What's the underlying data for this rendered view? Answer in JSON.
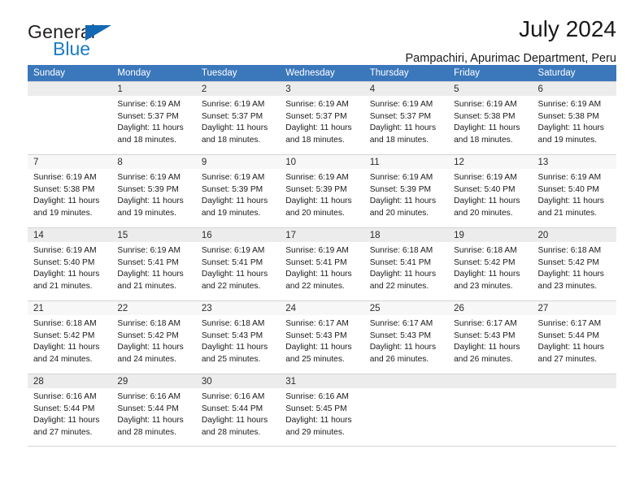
{
  "brand": {
    "name_part1": "General",
    "name_part2": "Blue",
    "triangle_color": "#1268b3",
    "blue_color": "#1b7bc4"
  },
  "header": {
    "title": "July 2024",
    "subtitle": "Pampachiri, Apurimac Department, Peru"
  },
  "colors": {
    "header_row_bg": "#3b77bb",
    "header_row_text": "#ffffff",
    "daynum_shaded": "#ececec",
    "daynum_plain": "#f7f7f7",
    "grid_line": "#d4d4d4"
  },
  "calendar": {
    "weekday_headers": [
      "Sunday",
      "Monday",
      "Tuesday",
      "Wednesday",
      "Thursday",
      "Friday",
      "Saturday"
    ],
    "weeks": [
      [
        {
          "day": "",
          "sunrise": "",
          "sunset": "",
          "daylight_line1": "",
          "daylight_line2": ""
        },
        {
          "day": "1",
          "sunrise": "Sunrise: 6:19 AM",
          "sunset": "Sunset: 5:37 PM",
          "daylight_line1": "Daylight: 11 hours",
          "daylight_line2": "and 18 minutes."
        },
        {
          "day": "2",
          "sunrise": "Sunrise: 6:19 AM",
          "sunset": "Sunset: 5:37 PM",
          "daylight_line1": "Daylight: 11 hours",
          "daylight_line2": "and 18 minutes."
        },
        {
          "day": "3",
          "sunrise": "Sunrise: 6:19 AM",
          "sunset": "Sunset: 5:37 PM",
          "daylight_line1": "Daylight: 11 hours",
          "daylight_line2": "and 18 minutes."
        },
        {
          "day": "4",
          "sunrise": "Sunrise: 6:19 AM",
          "sunset": "Sunset: 5:37 PM",
          "daylight_line1": "Daylight: 11 hours",
          "daylight_line2": "and 18 minutes."
        },
        {
          "day": "5",
          "sunrise": "Sunrise: 6:19 AM",
          "sunset": "Sunset: 5:38 PM",
          "daylight_line1": "Daylight: 11 hours",
          "daylight_line2": "and 18 minutes."
        },
        {
          "day": "6",
          "sunrise": "Sunrise: 6:19 AM",
          "sunset": "Sunset: 5:38 PM",
          "daylight_line1": "Daylight: 11 hours",
          "daylight_line2": "and 19 minutes."
        }
      ],
      [
        {
          "day": "7",
          "sunrise": "Sunrise: 6:19 AM",
          "sunset": "Sunset: 5:38 PM",
          "daylight_line1": "Daylight: 11 hours",
          "daylight_line2": "and 19 minutes."
        },
        {
          "day": "8",
          "sunrise": "Sunrise: 6:19 AM",
          "sunset": "Sunset: 5:39 PM",
          "daylight_line1": "Daylight: 11 hours",
          "daylight_line2": "and 19 minutes."
        },
        {
          "day": "9",
          "sunrise": "Sunrise: 6:19 AM",
          "sunset": "Sunset: 5:39 PM",
          "daylight_line1": "Daylight: 11 hours",
          "daylight_line2": "and 19 minutes."
        },
        {
          "day": "10",
          "sunrise": "Sunrise: 6:19 AM",
          "sunset": "Sunset: 5:39 PM",
          "daylight_line1": "Daylight: 11 hours",
          "daylight_line2": "and 20 minutes."
        },
        {
          "day": "11",
          "sunrise": "Sunrise: 6:19 AM",
          "sunset": "Sunset: 5:39 PM",
          "daylight_line1": "Daylight: 11 hours",
          "daylight_line2": "and 20 minutes."
        },
        {
          "day": "12",
          "sunrise": "Sunrise: 6:19 AM",
          "sunset": "Sunset: 5:40 PM",
          "daylight_line1": "Daylight: 11 hours",
          "daylight_line2": "and 20 minutes."
        },
        {
          "day": "13",
          "sunrise": "Sunrise: 6:19 AM",
          "sunset": "Sunset: 5:40 PM",
          "daylight_line1": "Daylight: 11 hours",
          "daylight_line2": "and 21 minutes."
        }
      ],
      [
        {
          "day": "14",
          "sunrise": "Sunrise: 6:19 AM",
          "sunset": "Sunset: 5:40 PM",
          "daylight_line1": "Daylight: 11 hours",
          "daylight_line2": "and 21 minutes."
        },
        {
          "day": "15",
          "sunrise": "Sunrise: 6:19 AM",
          "sunset": "Sunset: 5:41 PM",
          "daylight_line1": "Daylight: 11 hours",
          "daylight_line2": "and 21 minutes."
        },
        {
          "day": "16",
          "sunrise": "Sunrise: 6:19 AM",
          "sunset": "Sunset: 5:41 PM",
          "daylight_line1": "Daylight: 11 hours",
          "daylight_line2": "and 22 minutes."
        },
        {
          "day": "17",
          "sunrise": "Sunrise: 6:19 AM",
          "sunset": "Sunset: 5:41 PM",
          "daylight_line1": "Daylight: 11 hours",
          "daylight_line2": "and 22 minutes."
        },
        {
          "day": "18",
          "sunrise": "Sunrise: 6:18 AM",
          "sunset": "Sunset: 5:41 PM",
          "daylight_line1": "Daylight: 11 hours",
          "daylight_line2": "and 22 minutes."
        },
        {
          "day": "19",
          "sunrise": "Sunrise: 6:18 AM",
          "sunset": "Sunset: 5:42 PM",
          "daylight_line1": "Daylight: 11 hours",
          "daylight_line2": "and 23 minutes."
        },
        {
          "day": "20",
          "sunrise": "Sunrise: 6:18 AM",
          "sunset": "Sunset: 5:42 PM",
          "daylight_line1": "Daylight: 11 hours",
          "daylight_line2": "and 23 minutes."
        }
      ],
      [
        {
          "day": "21",
          "sunrise": "Sunrise: 6:18 AM",
          "sunset": "Sunset: 5:42 PM",
          "daylight_line1": "Daylight: 11 hours",
          "daylight_line2": "and 24 minutes."
        },
        {
          "day": "22",
          "sunrise": "Sunrise: 6:18 AM",
          "sunset": "Sunset: 5:42 PM",
          "daylight_line1": "Daylight: 11 hours",
          "daylight_line2": "and 24 minutes."
        },
        {
          "day": "23",
          "sunrise": "Sunrise: 6:18 AM",
          "sunset": "Sunset: 5:43 PM",
          "daylight_line1": "Daylight: 11 hours",
          "daylight_line2": "and 25 minutes."
        },
        {
          "day": "24",
          "sunrise": "Sunrise: 6:17 AM",
          "sunset": "Sunset: 5:43 PM",
          "daylight_line1": "Daylight: 11 hours",
          "daylight_line2": "and 25 minutes."
        },
        {
          "day": "25",
          "sunrise": "Sunrise: 6:17 AM",
          "sunset": "Sunset: 5:43 PM",
          "daylight_line1": "Daylight: 11 hours",
          "daylight_line2": "and 26 minutes."
        },
        {
          "day": "26",
          "sunrise": "Sunrise: 6:17 AM",
          "sunset": "Sunset: 5:43 PM",
          "daylight_line1": "Daylight: 11 hours",
          "daylight_line2": "and 26 minutes."
        },
        {
          "day": "27",
          "sunrise": "Sunrise: 6:17 AM",
          "sunset": "Sunset: 5:44 PM",
          "daylight_line1": "Daylight: 11 hours",
          "daylight_line2": "and 27 minutes."
        }
      ],
      [
        {
          "day": "28",
          "sunrise": "Sunrise: 6:16 AM",
          "sunset": "Sunset: 5:44 PM",
          "daylight_line1": "Daylight: 11 hours",
          "daylight_line2": "and 27 minutes."
        },
        {
          "day": "29",
          "sunrise": "Sunrise: 6:16 AM",
          "sunset": "Sunset: 5:44 PM",
          "daylight_line1": "Daylight: 11 hours",
          "daylight_line2": "and 28 minutes."
        },
        {
          "day": "30",
          "sunrise": "Sunrise: 6:16 AM",
          "sunset": "Sunset: 5:44 PM",
          "daylight_line1": "Daylight: 11 hours",
          "daylight_line2": "and 28 minutes."
        },
        {
          "day": "31",
          "sunrise": "Sunrise: 6:16 AM",
          "sunset": "Sunset: 5:45 PM",
          "daylight_line1": "Daylight: 11 hours",
          "daylight_line2": "and 29 minutes."
        },
        {
          "day": "",
          "sunrise": "",
          "sunset": "",
          "daylight_line1": "",
          "daylight_line2": ""
        },
        {
          "day": "",
          "sunrise": "",
          "sunset": "",
          "daylight_line1": "",
          "daylight_line2": ""
        },
        {
          "day": "",
          "sunrise": "",
          "sunset": "",
          "daylight_line1": "",
          "daylight_line2": ""
        }
      ]
    ]
  }
}
